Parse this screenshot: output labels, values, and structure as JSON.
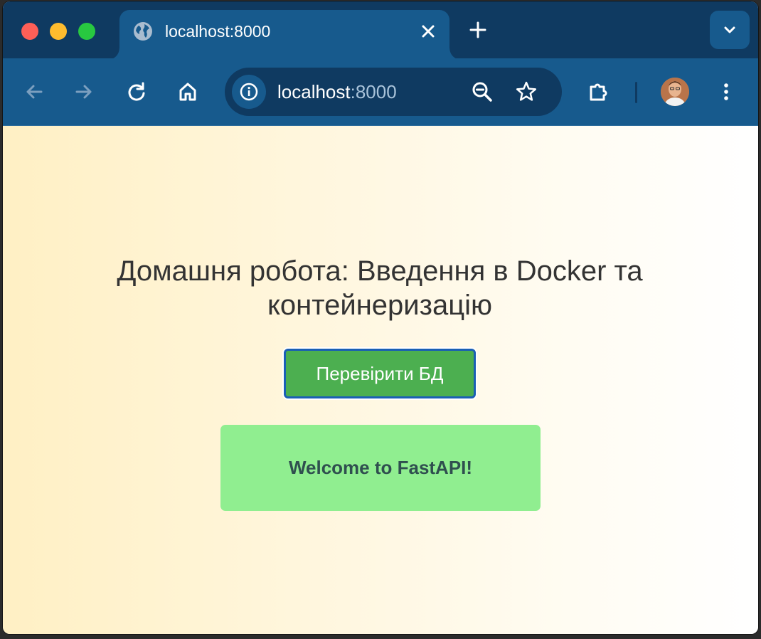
{
  "browser": {
    "tab": {
      "title": "localhost:8000",
      "icon": "globe-icon"
    },
    "toolbar": {
      "url_host": "localhost",
      "url_port": ":8000",
      "icons": [
        "back-arrow-icon",
        "forward-arrow-icon",
        "reload-icon",
        "home-icon",
        "site-info-icon",
        "zoom-icon",
        "star-icon",
        "extensions-icon",
        "avatar",
        "menu-dots-icon"
      ]
    },
    "colors": {
      "tabstrip": "#0f3a61",
      "toolbar": "#175a8d"
    }
  },
  "page": {
    "title": "Домашня робота: Введення в Docker та контейнеризацію",
    "check_db_button": "Перевірити БД",
    "message": "Welcome to FastAPI!",
    "colors": {
      "button": "#4caf50",
      "message_bg": "#90ee90",
      "message_text": "#2f4f4f"
    }
  }
}
